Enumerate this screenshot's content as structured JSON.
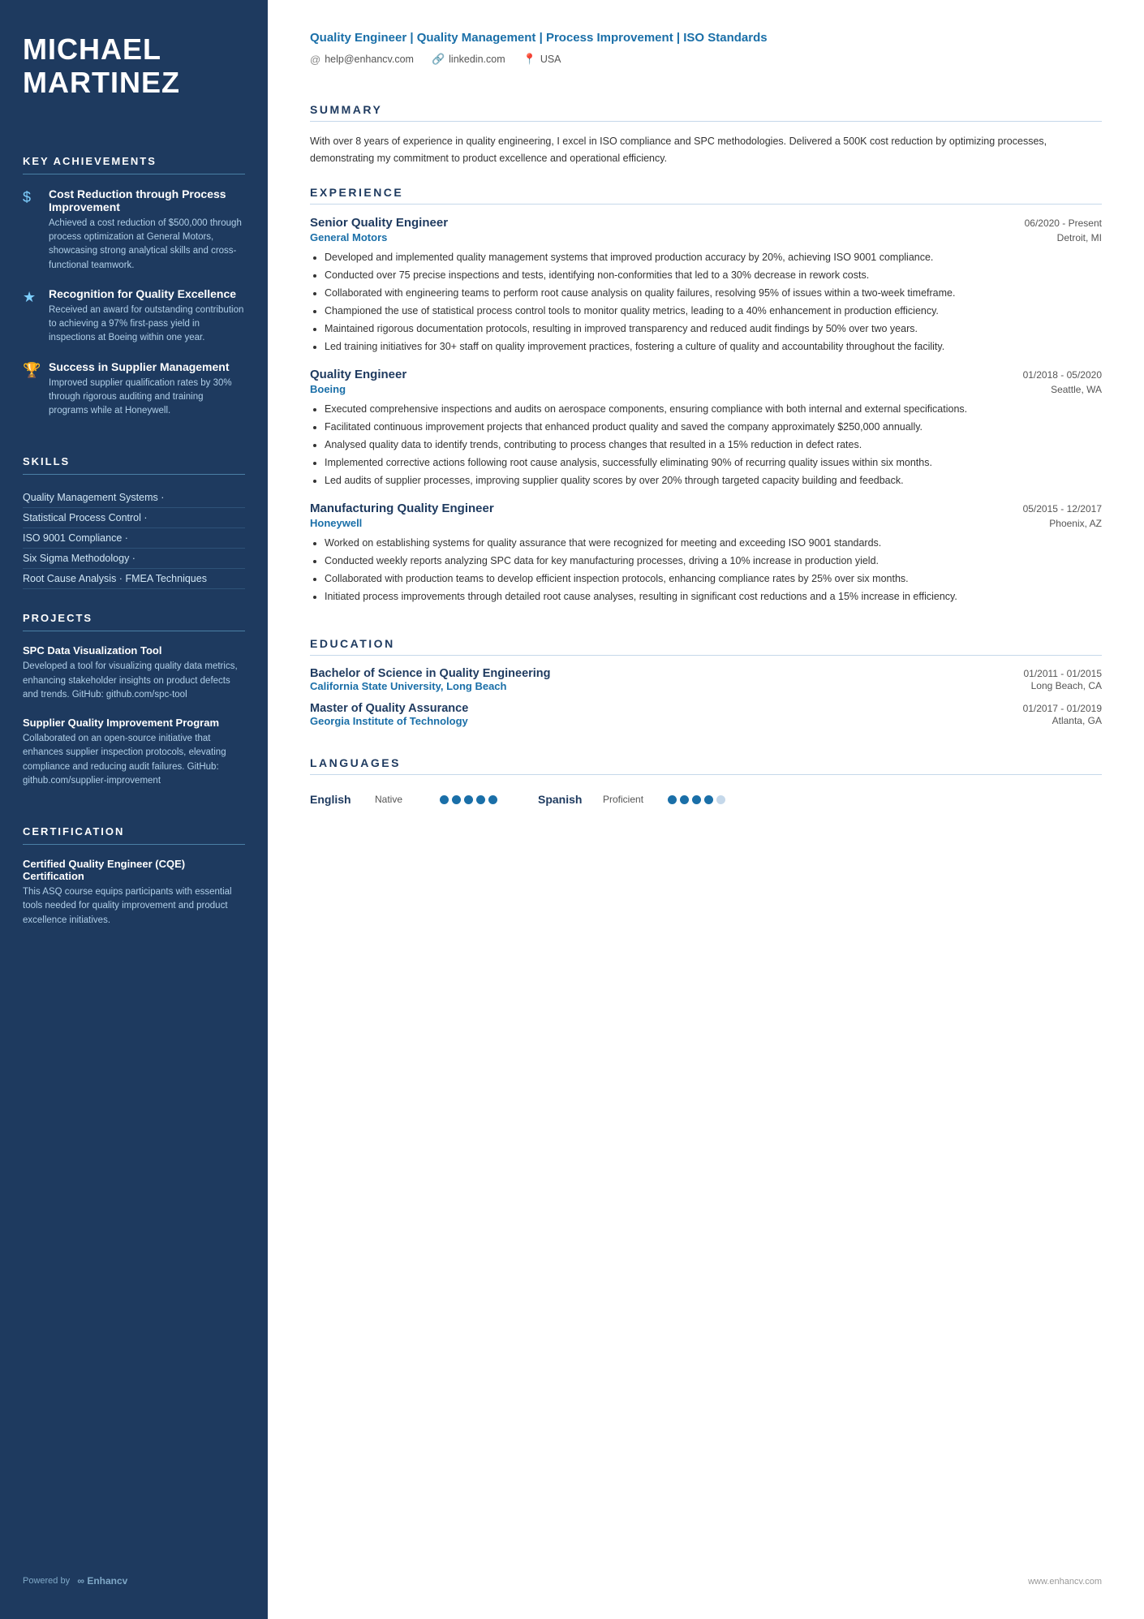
{
  "sidebar": {
    "name": "MICHAEL\nMARTINEZ",
    "sections": {
      "achievements": {
        "title": "KEY ACHIEVEMENTS",
        "items": [
          {
            "icon": "$",
            "title": "Cost Reduction through Process Improvement",
            "desc": "Achieved a cost reduction of $500,000 through process optimization at General Motors, showcasing strong analytical skills and cross-functional teamwork."
          },
          {
            "icon": "★",
            "title": "Recognition for Quality Excellence",
            "desc": "Received an award for outstanding contribution to achieving a 97% first-pass yield in inspections at Boeing within one year."
          },
          {
            "icon": "🏆",
            "title": "Success in Supplier Management",
            "desc": "Improved supplier qualification rates by 30% through rigorous auditing and training programs while at Honeywell."
          }
        ]
      },
      "skills": {
        "title": "SKILLS",
        "items": [
          "Quality Management Systems ·",
          "Statistical Process Control ·",
          "ISO 9001 Compliance ·",
          "Six Sigma Methodology ·",
          "Root Cause Analysis · FMEA Techniques"
        ]
      },
      "projects": {
        "title": "PROJECTS",
        "items": [
          {
            "title": "SPC Data Visualization Tool",
            "desc": "Developed a tool for visualizing quality data metrics, enhancing stakeholder insights on product defects and trends. GitHub: github.com/spc-tool"
          },
          {
            "title": "Supplier Quality Improvement Program",
            "desc": "Collaborated on an open-source initiative that enhances supplier inspection protocols, elevating compliance and reducing audit failures. GitHub: github.com/supplier-improvement"
          }
        ]
      },
      "certification": {
        "title": "CERTIFICATION",
        "cert_title": "Certified Quality Engineer (CQE) Certification",
        "cert_desc": "This ASQ course equips participants with essential tools needed for quality improvement and product excellence initiatives."
      }
    },
    "footer": {
      "powered_by": "Powered by",
      "brand": "Enhancv"
    }
  },
  "main": {
    "header": {
      "title": "Quality Engineer | Quality Management | Process Improvement | ISO Standards",
      "contacts": [
        {
          "icon": "@",
          "text": "help@enhancv.com"
        },
        {
          "icon": "🔗",
          "text": "linkedin.com"
        },
        {
          "icon": "📍",
          "text": "USA"
        }
      ]
    },
    "summary": {
      "title": "SUMMARY",
      "text": "With over 8 years of experience in quality engineering, I excel in ISO compliance and SPC methodologies. Delivered a 500K cost reduction by optimizing processes, demonstrating my commitment to product excellence and operational efficiency."
    },
    "experience": {
      "title": "EXPERIENCE",
      "jobs": [
        {
          "role": "Senior Quality Engineer",
          "date": "06/2020 - Present",
          "company": "General Motors",
          "location": "Detroit, MI",
          "bullets": [
            "Developed and implemented quality management systems that improved production accuracy by 20%, achieving ISO 9001 compliance.",
            "Conducted over 75 precise inspections and tests, identifying non-conformities that led to a 30% decrease in rework costs.",
            "Collaborated with engineering teams to perform root cause analysis on quality failures, resolving 95% of issues within a two-week timeframe.",
            "Championed the use of statistical process control tools to monitor quality metrics, leading to a 40% enhancement in production efficiency.",
            "Maintained rigorous documentation protocols, resulting in improved transparency and reduced audit findings by 50% over two years.",
            "Led training initiatives for 30+ staff on quality improvement practices, fostering a culture of quality and accountability throughout the facility."
          ]
        },
        {
          "role": "Quality Engineer",
          "date": "01/2018 - 05/2020",
          "company": "Boeing",
          "location": "Seattle, WA",
          "bullets": [
            "Executed comprehensive inspections and audits on aerospace components, ensuring compliance with both internal and external specifications.",
            "Facilitated continuous improvement projects that enhanced product quality and saved the company approximately $250,000 annually.",
            "Analysed quality data to identify trends, contributing to process changes that resulted in a 15% reduction in defect rates.",
            "Implemented corrective actions following root cause analysis, successfully eliminating 90% of recurring quality issues within six months.",
            "Led audits of supplier processes, improving supplier quality scores by over 20% through targeted capacity building and feedback."
          ]
        },
        {
          "role": "Manufacturing Quality Engineer",
          "date": "05/2015 - 12/2017",
          "company": "Honeywell",
          "location": "Phoenix, AZ",
          "bullets": [
            "Worked on establishing systems for quality assurance that were recognized for meeting and exceeding ISO 9001 standards.",
            "Conducted weekly reports analyzing SPC data for key manufacturing processes, driving a 10% increase in production yield.",
            "Collaborated with production teams to develop efficient inspection protocols, enhancing compliance rates by 25% over six months.",
            "Initiated process improvements through detailed root cause analyses, resulting in significant cost reductions and a 15% increase in efficiency."
          ]
        }
      ]
    },
    "education": {
      "title": "EDUCATION",
      "items": [
        {
          "degree": "Bachelor of Science in Quality Engineering",
          "date": "01/2011 - 01/2015",
          "institution": "California State University, Long Beach",
          "location": "Long Beach, CA"
        },
        {
          "degree": "Master of Quality Assurance",
          "date": "01/2017 - 01/2019",
          "institution": "Georgia Institute of Technology",
          "location": "Atlanta, GA"
        }
      ]
    },
    "languages": {
      "title": "LANGUAGES",
      "items": [
        {
          "name": "English",
          "level": "Native",
          "dots": 5,
          "filled": 5
        },
        {
          "name": "Spanish",
          "level": "Proficient",
          "dots": 5,
          "filled": 4
        }
      ]
    },
    "footer": {
      "text": "www.enhancv.com"
    }
  }
}
